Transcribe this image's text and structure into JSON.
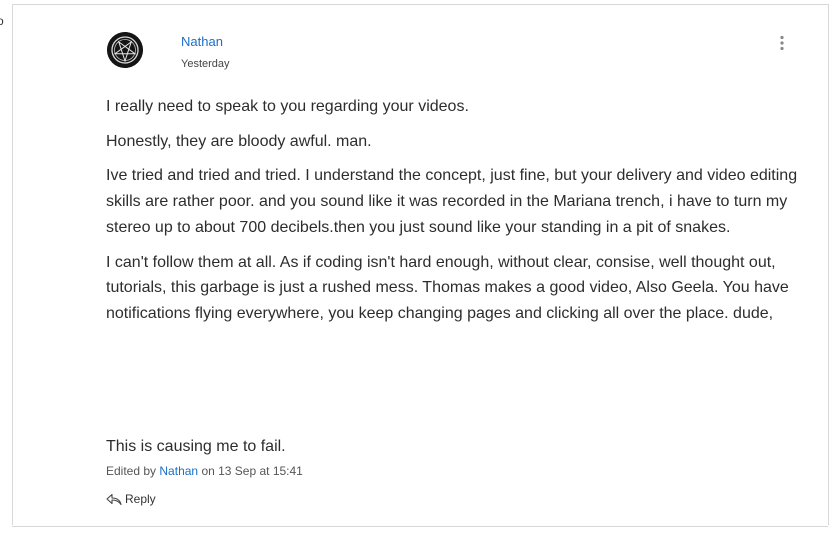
{
  "edge_glyph": "o",
  "post": {
    "author": "Nathan",
    "timestamp": "Yesterday",
    "paragraphs": [
      "I really need to speak to you regarding your videos.",
      "Honestly, they are bloody awful. man.",
      "Ive tried and tried and tried. I understand the concept, just fine, but your delivery and video editing skills are rather poor. and you sound like it was recorded in the Mariana trench, i have to turn my stereo up to about 700 decibels.then you just sound like your standing in a pit of snakes.",
      "I can't follow them at all. As if coding isn't hard enough, without clear, consise, well thought out, tutorials, this garbage is just a rushed mess. Thomas makes a good video, Also Geela. You have notifications flying everywhere, you keep changing pages and clicking all over the place. dude,"
    ],
    "final_line": "This is causing me to fail.",
    "edited_prefix": "Edited by",
    "edited_by": "Nathan",
    "edited_suffix": "on 13 Sep at 15:41",
    "reply_label": "Reply"
  },
  "icons": {
    "avatar": "pentagram-avatar",
    "menu": "kebab-menu-icon",
    "reply": "reply-arrow-icon"
  },
  "colors": {
    "link": "#1a6fc9",
    "text": "#2d2d2d",
    "border": "#d8d8d8"
  }
}
